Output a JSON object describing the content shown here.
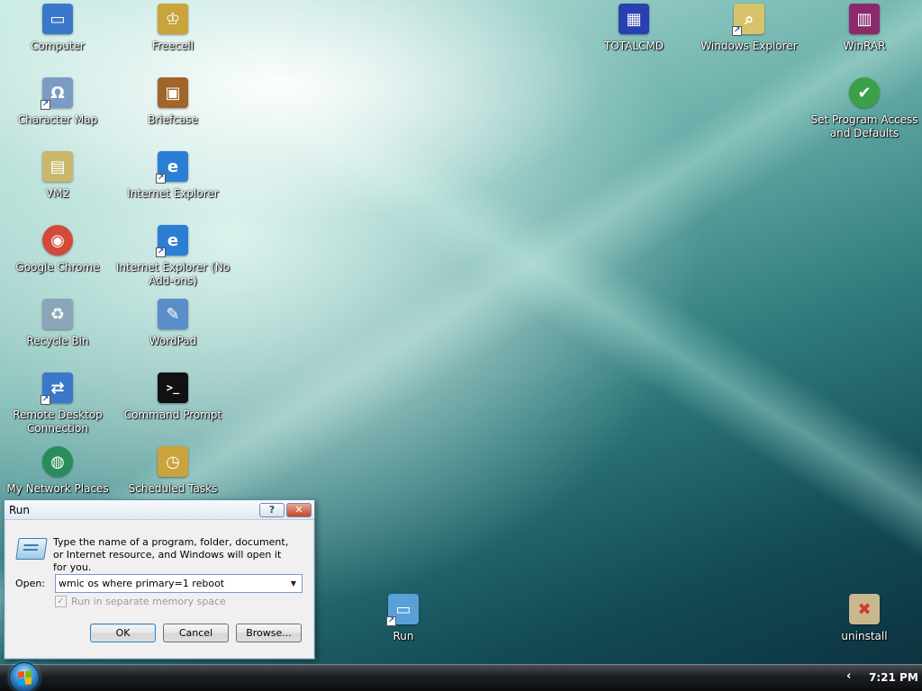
{
  "desktop": {
    "icons": [
      {
        "label": "Computer",
        "glyph": "▭",
        "color": "#3b78c9"
      },
      {
        "label": "Freecell",
        "glyph": "♔",
        "color": "#c9a33b"
      },
      {
        "label": "Character Map",
        "glyph": "Ω",
        "color": "#7a9cc4"
      },
      {
        "label": "Briefcase",
        "glyph": "▣",
        "color": "#a0652a"
      },
      {
        "label": "VM2",
        "glyph": "▤",
        "color": "#c9b86a"
      },
      {
        "label": "Internet Explorer",
        "glyph": "e",
        "color": "#2a7fd4"
      },
      {
        "label": "Google Chrome",
        "glyph": "◉",
        "color": "#d44a3a"
      },
      {
        "label": "Internet Explorer (No Add-ons)",
        "glyph": "e",
        "color": "#2a7fd4"
      },
      {
        "label": "Recycle Bin",
        "glyph": "♻",
        "color": "#8aa6b8"
      },
      {
        "label": "WordPad",
        "glyph": "✎",
        "color": "#5a8ec8"
      },
      {
        "label": "Remote Desktop Connection",
        "glyph": "⇄",
        "color": "#3b78c9"
      },
      {
        "label": "Command Prompt",
        "glyph": ">_",
        "color": "#111111"
      },
      {
        "label": "My Network Places",
        "glyph": "◍",
        "color": "#2a8c5a"
      },
      {
        "label": "Scheduled Tasks",
        "glyph": "◷",
        "color": "#c9a33b"
      },
      {
        "label": "TOTALCMD",
        "glyph": "▦",
        "color": "#2a3fb0"
      },
      {
        "label": "Windows Explorer",
        "glyph": "⌕",
        "color": "#d8c36a"
      },
      {
        "label": "WinRAR",
        "glyph": "▥",
        "color": "#8a2a6a"
      },
      {
        "label": "Set Program Access and Defaults",
        "glyph": "✔",
        "color": "#3aa04a"
      },
      {
        "label": "Run",
        "glyph": "▭",
        "color": "#5aa0d8"
      },
      {
        "label": "uninstall",
        "glyph": "✖",
        "color": "#c8b890"
      }
    ]
  },
  "run_dialog": {
    "title": "Run",
    "help_label": "?",
    "close_label": "✕",
    "description": "Type the name of a program, folder, document, or Internet resource, and Windows will open it for you.",
    "open_label": "Open:",
    "open_value": "wmic os where primary=1 reboot",
    "separate_memory_label": "Run in separate memory space",
    "ok_label": "OK",
    "cancel_label": "Cancel",
    "browse_label": "Browse..."
  },
  "taskbar": {
    "tray_arrow": "‹",
    "clock": "7:21 PM"
  }
}
